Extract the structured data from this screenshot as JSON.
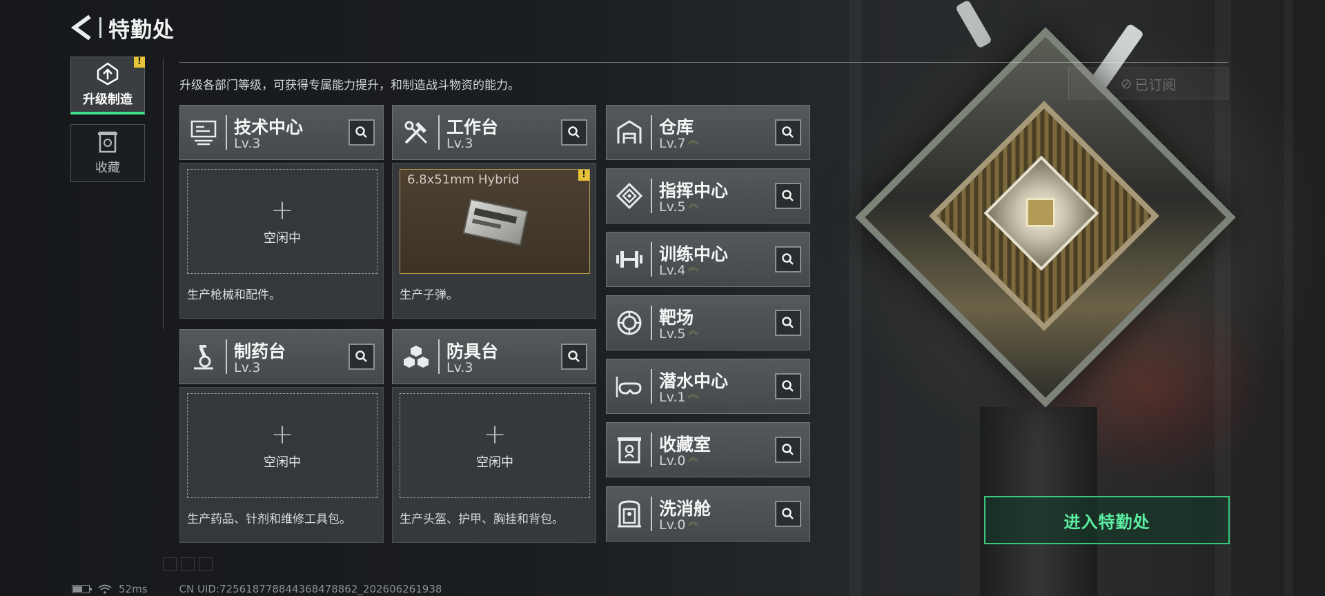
{
  "header": {
    "title": "特勤处"
  },
  "side_tabs": [
    {
      "label": "升级制造",
      "badge": "!"
    },
    {
      "label": "收藏"
    }
  ],
  "description": "升级各部门等级，可获得专属能力提升，和制造战斗物资的能力。",
  "subscribed_label": "已订阅",
  "facilities": {
    "tech_center": {
      "name": "技术中心",
      "level": "Lv.3",
      "slot_status": "空闲中",
      "slot_plus": "+",
      "desc": "生产枪械和配件。"
    },
    "workbench": {
      "name": "工作台",
      "level": "Lv.3",
      "product": "6.8x51mm Hybrid",
      "badge": "!",
      "desc": "生产子弹。"
    },
    "pharmacy": {
      "name": "制药台",
      "level": "Lv.3",
      "slot_status": "空闲中",
      "slot_plus": "+",
      "desc": "生产药品、针剂和维修工具包。"
    },
    "armor_bench": {
      "name": "防具台",
      "level": "Lv.3",
      "slot_status": "空闲中",
      "slot_plus": "+",
      "desc": "生产头盔、护甲、胸挂和背包。"
    }
  },
  "right_list": [
    {
      "name": "仓库",
      "level": "Lv.7",
      "icon": "warehouse-icon"
    },
    {
      "name": "指挥中心",
      "level": "Lv.5",
      "icon": "command-center-icon"
    },
    {
      "name": "训练中心",
      "level": "Lv.4",
      "icon": "dumbbell-icon"
    },
    {
      "name": "靶场",
      "level": "Lv.5",
      "icon": "target-icon"
    },
    {
      "name": "潜水中心",
      "level": "Lv.1",
      "icon": "diving-mask-icon"
    },
    {
      "name": "收藏室",
      "level": "Lv.0",
      "icon": "collection-room-icon"
    },
    {
      "name": "洗消舱",
      "level": "Lv.0",
      "icon": "decontamination-icon"
    }
  ],
  "upgrade_chevron": "︽",
  "enter_button": "进入特勤处",
  "footer": {
    "ping": "52ms",
    "uid": "CN UID:725618778844368478862_202606261938",
    "battery_level": 0.55
  },
  "colors": {
    "accent_green": "#3fe08c",
    "warning_yellow": "#e7c33a",
    "product_border": "#b79b49"
  }
}
